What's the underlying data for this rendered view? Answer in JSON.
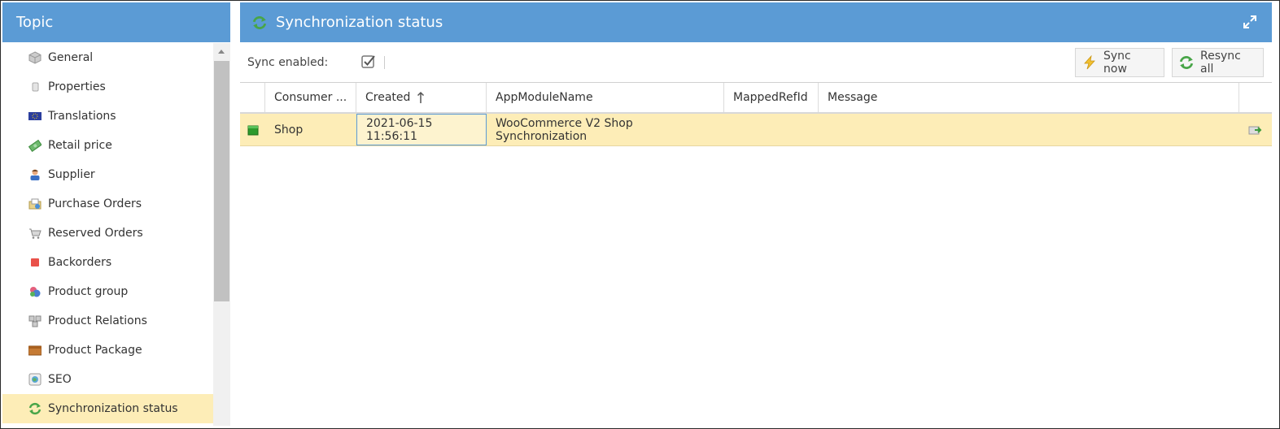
{
  "left_panel": {
    "title": "Topic",
    "items": [
      {
        "label": "General",
        "icon": "cube-icon"
      },
      {
        "label": "Properties",
        "icon": "document-icon"
      },
      {
        "label": "Translations",
        "icon": "eu-flag-icon"
      },
      {
        "label": "Retail price",
        "icon": "money-icon"
      },
      {
        "label": "Supplier",
        "icon": "person-icon"
      },
      {
        "label": "Purchase Orders",
        "icon": "purchase-order-icon"
      },
      {
        "label": "Reserved Orders",
        "icon": "cart-icon"
      },
      {
        "label": "Backorders",
        "icon": "red-square-icon"
      },
      {
        "label": "Product group",
        "icon": "product-group-icon"
      },
      {
        "label": "Product Relations",
        "icon": "relations-icon"
      },
      {
        "label": "Product Package",
        "icon": "package-icon"
      },
      {
        "label": "SEO",
        "icon": "seo-icon"
      },
      {
        "label": "Synchronization status",
        "icon": "sync-icon"
      }
    ]
  },
  "right_panel": {
    "title": "Synchronization status",
    "toolbar": {
      "sync_enabled_label": "Sync enabled:",
      "sync_enabled": true,
      "sync_now_label": "Sync now",
      "resync_all_label": "Resync all"
    },
    "grid": {
      "columns": [
        "Consumer ...",
        "Created",
        "AppModuleName",
        "MappedRefId",
        "Message"
      ],
      "rows": [
        {
          "consumer": "Shop",
          "created": "2021-06-15 11:56:11",
          "app_module": "WooCommerce V2 Shop Synchronization",
          "mapped_ref_id": "",
          "message": ""
        }
      ]
    }
  },
  "colors": {
    "header_blue": "#5b9bd5",
    "selected_row": "#fdedb7"
  }
}
